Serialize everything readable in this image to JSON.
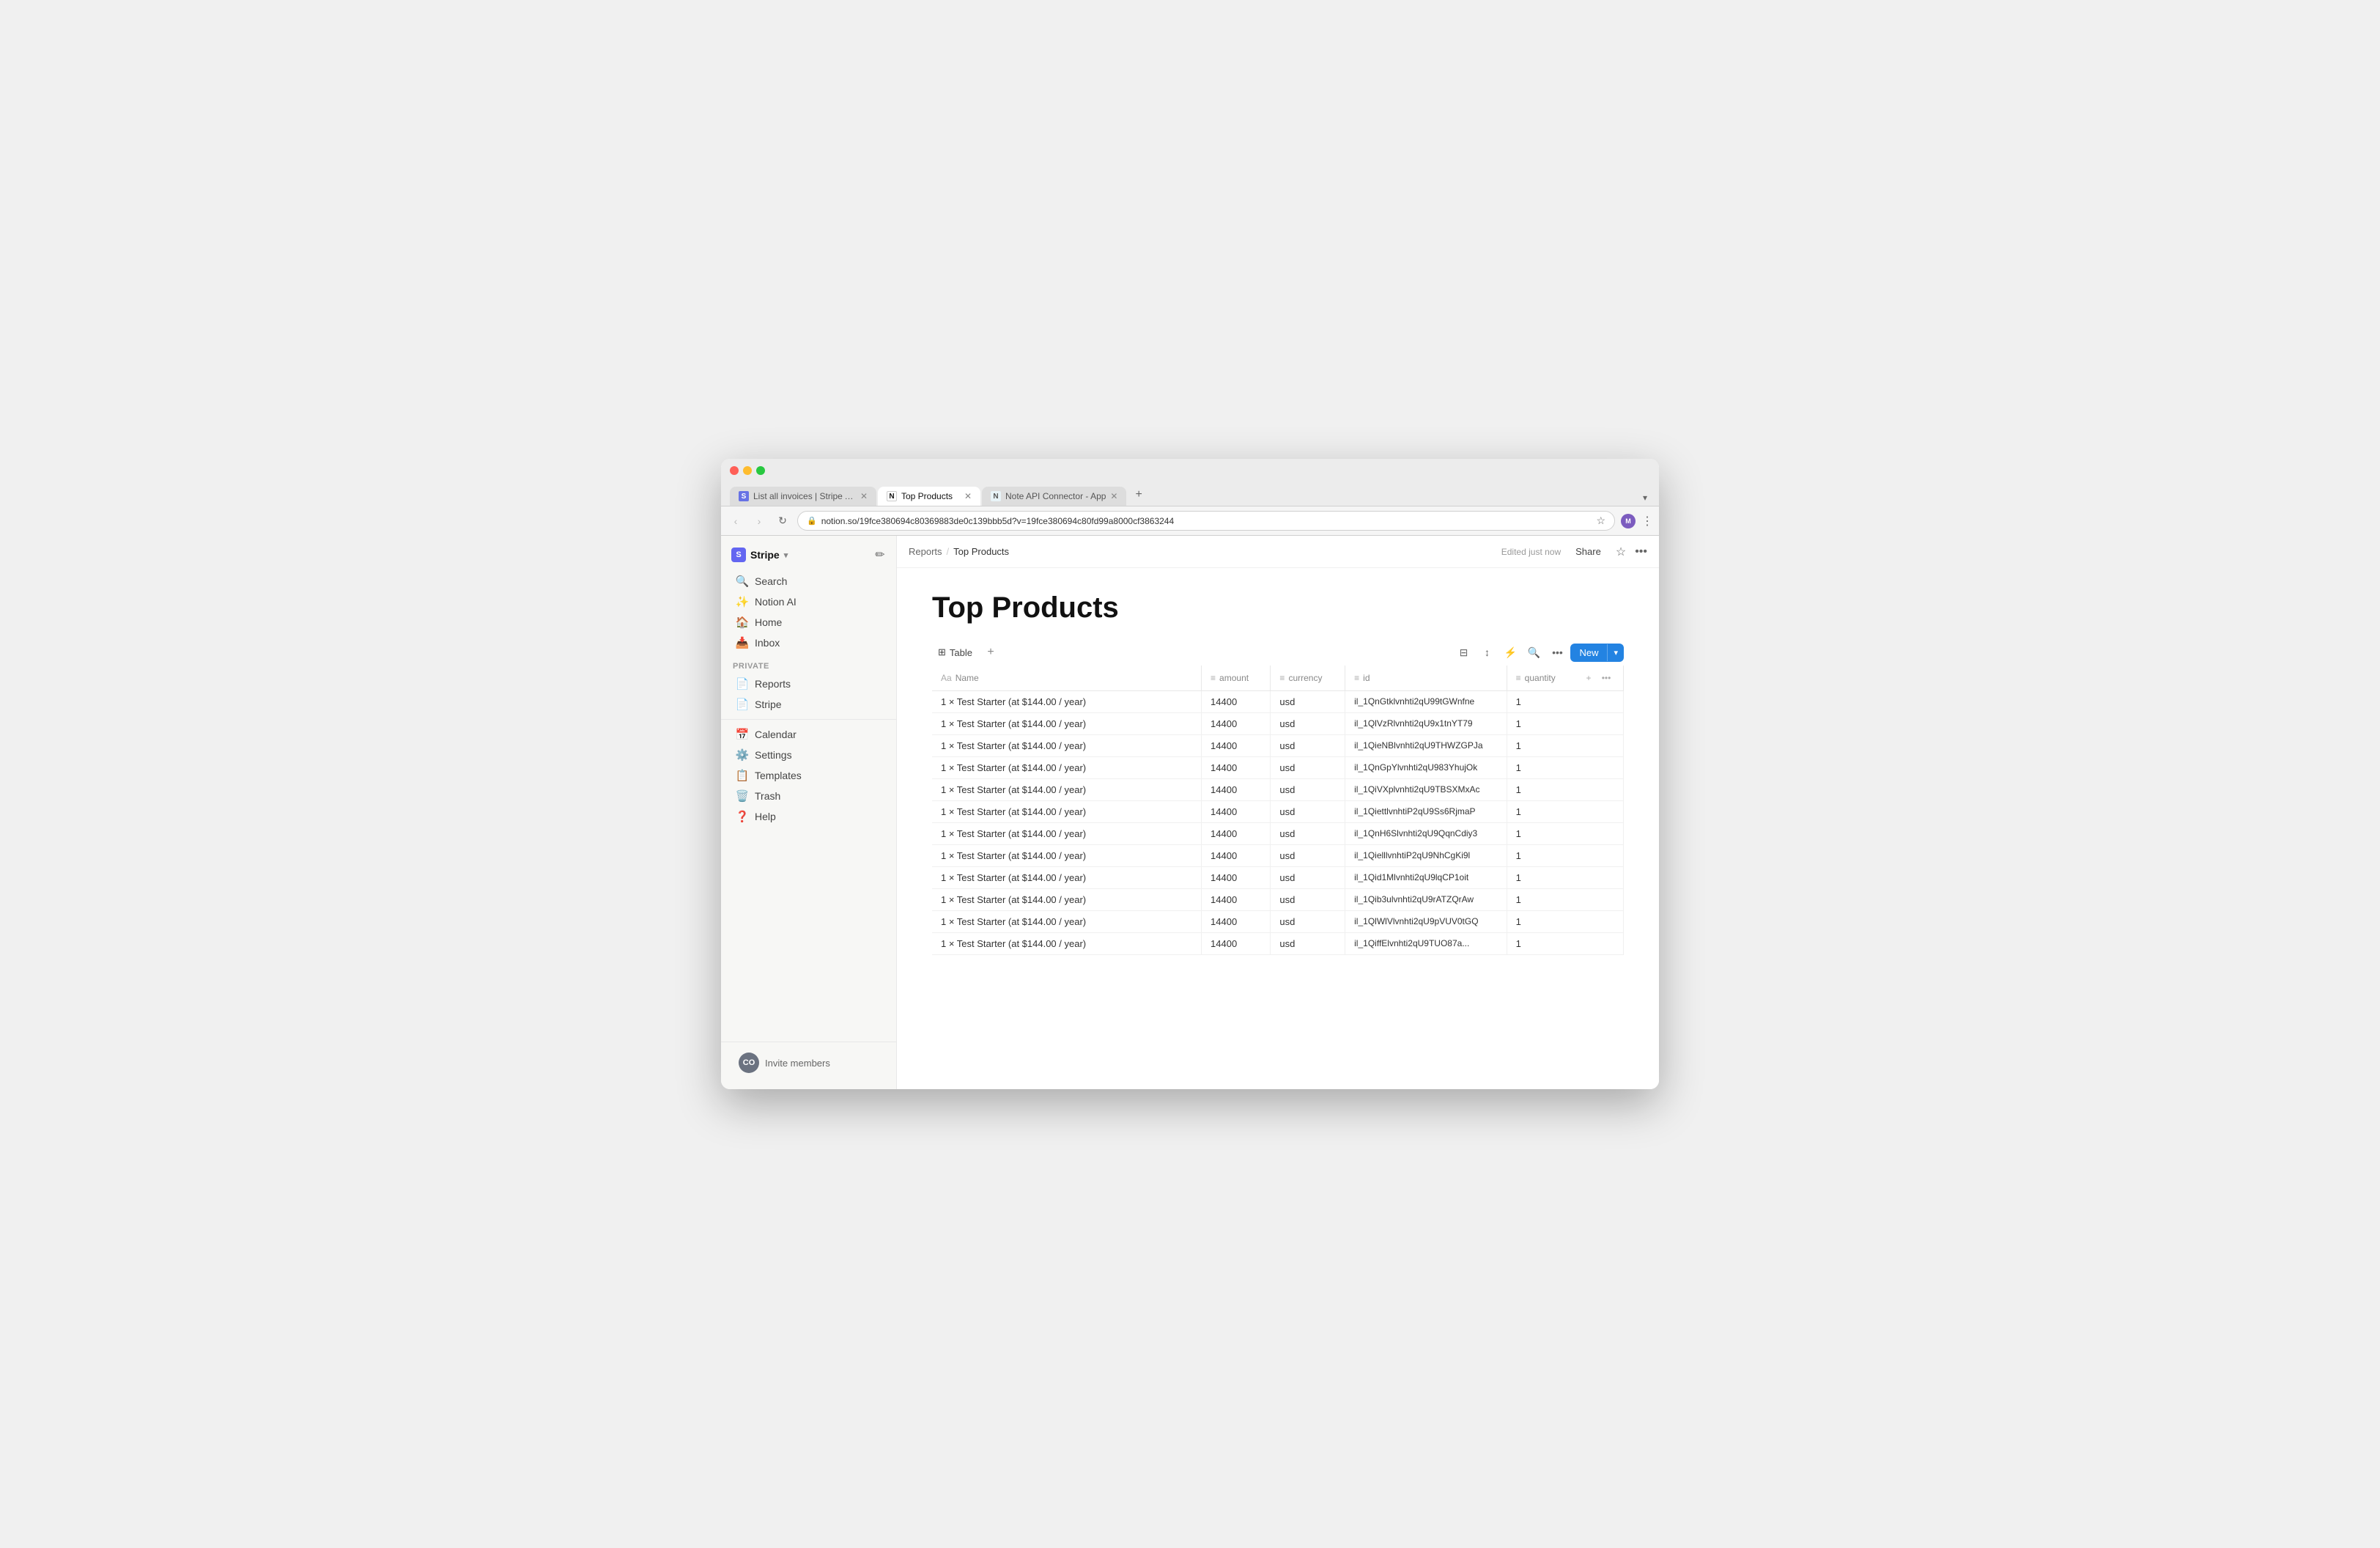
{
  "browser": {
    "tabs": [
      {
        "id": "tab1",
        "favicon_type": "stripe",
        "favicon_label": "S",
        "label": "List all invoices | Stripe API R...",
        "active": false
      },
      {
        "id": "tab2",
        "favicon_type": "notion",
        "favicon_label": "N",
        "label": "Top Products",
        "active": true
      },
      {
        "id": "tab3",
        "favicon_type": "note",
        "favicon_label": "N",
        "label": "Note API Connector - App",
        "active": false
      }
    ],
    "new_tab_icon": "+",
    "address": "notion.so/19fce380694c80369883de0c139bbb5d?v=19fce380694c80fd99a8000cf3863244",
    "profile_initials": "M"
  },
  "sidebar": {
    "workspace_name": "Stripe",
    "workspace_icon": "S",
    "items_top": [
      {
        "id": "search",
        "icon": "🔍",
        "label": "Search"
      },
      {
        "id": "notion-ai",
        "icon": "✨",
        "label": "Notion AI"
      },
      {
        "id": "home",
        "icon": "🏠",
        "label": "Home"
      },
      {
        "id": "inbox",
        "icon": "📥",
        "label": "Inbox"
      }
    ],
    "section_label": "Private",
    "items_private": [
      {
        "id": "reports",
        "icon": "📄",
        "label": "Reports"
      },
      {
        "id": "stripe",
        "icon": "📄",
        "label": "Stripe"
      }
    ],
    "items_bottom": [
      {
        "id": "calendar",
        "icon": "📅",
        "label": "Calendar"
      },
      {
        "id": "settings",
        "icon": "⚙️",
        "label": "Settings"
      },
      {
        "id": "templates",
        "icon": "📋",
        "label": "Templates"
      },
      {
        "id": "trash",
        "icon": "🗑️",
        "label": "Trash"
      },
      {
        "id": "help",
        "icon": "❓",
        "label": "Help"
      }
    ],
    "invite_members_label": "Invite members",
    "user_initials": "CO"
  },
  "page": {
    "breadcrumb_parent": "Reports",
    "breadcrumb_current": "Top Products",
    "edited_text": "Edited just now",
    "share_label": "Share",
    "title": "Top Products",
    "table_view_label": "Table",
    "add_view_icon": "+",
    "new_button_label": "New",
    "columns": [
      {
        "id": "name",
        "icon": "Aa",
        "label": "Name"
      },
      {
        "id": "amount",
        "icon": "≡",
        "label": "amount"
      },
      {
        "id": "currency",
        "icon": "≡",
        "label": "currency"
      },
      {
        "id": "id",
        "icon": "≡",
        "label": "id"
      },
      {
        "id": "quantity",
        "icon": "≡",
        "label": "quantity"
      }
    ],
    "rows": [
      {
        "name": "1 × Test Starter (at $144.00 / year)",
        "amount": "14400",
        "currency": "usd",
        "id": "il_1QnGtklvnhti2qU99tGWnfne",
        "quantity": "1"
      },
      {
        "name": "1 × Test Starter (at $144.00 / year)",
        "amount": "14400",
        "currency": "usd",
        "id": "il_1QlVzRlvnhti2qU9x1tnYT79",
        "quantity": "1"
      },
      {
        "name": "1 × Test Starter (at $144.00 / year)",
        "amount": "14400",
        "currency": "usd",
        "id": "il_1QieNBlvnhti2qU9THWZGPJa",
        "quantity": "1"
      },
      {
        "name": "1 × Test Starter (at $144.00 / year)",
        "amount": "14400",
        "currency": "usd",
        "id": "il_1QnGpYlvnhti2qU983YhujOk",
        "quantity": "1"
      },
      {
        "name": "1 × Test Starter (at $144.00 / year)",
        "amount": "14400",
        "currency": "usd",
        "id": "il_1QiVXplvnhti2qU9TBSXMxAc",
        "quantity": "1"
      },
      {
        "name": "1 × Test Starter (at $144.00 / year)",
        "amount": "14400",
        "currency": "usd",
        "id": "il_1QiettlvnhtiP2qU9Ss6RjmaP",
        "quantity": "1"
      },
      {
        "name": "1 × Test Starter (at $144.00 / year)",
        "amount": "14400",
        "currency": "usd",
        "id": "il_1QnH6Slvnhti2qU9QqnCdiy3",
        "quantity": "1"
      },
      {
        "name": "1 × Test Starter (at $144.00 / year)",
        "amount": "14400",
        "currency": "usd",
        "id": "il_1QielllvnhtiP2qU9NhCgKi9l",
        "quantity": "1"
      },
      {
        "name": "1 × Test Starter (at $144.00 / year)",
        "amount": "14400",
        "currency": "usd",
        "id": "il_1Qid1Mlvnhti2qU9lqCP1oit",
        "quantity": "1"
      },
      {
        "name": "1 × Test Starter (at $144.00 / year)",
        "amount": "14400",
        "currency": "usd",
        "id": "il_1Qib3ulvnhti2qU9rATZQrAw",
        "quantity": "1"
      },
      {
        "name": "1 × Test Starter (at $144.00 / year)",
        "amount": "14400",
        "currency": "usd",
        "id": "il_1QlWlVlvnhti2qU9pVUV0tGQ",
        "quantity": "1"
      },
      {
        "name": "1 × Test Starter (at $144.00 / year)",
        "amount": "14400",
        "currency": "usd",
        "id": "il_1QiffElvnhti2qU9TUO87a...",
        "quantity": "1"
      }
    ]
  }
}
